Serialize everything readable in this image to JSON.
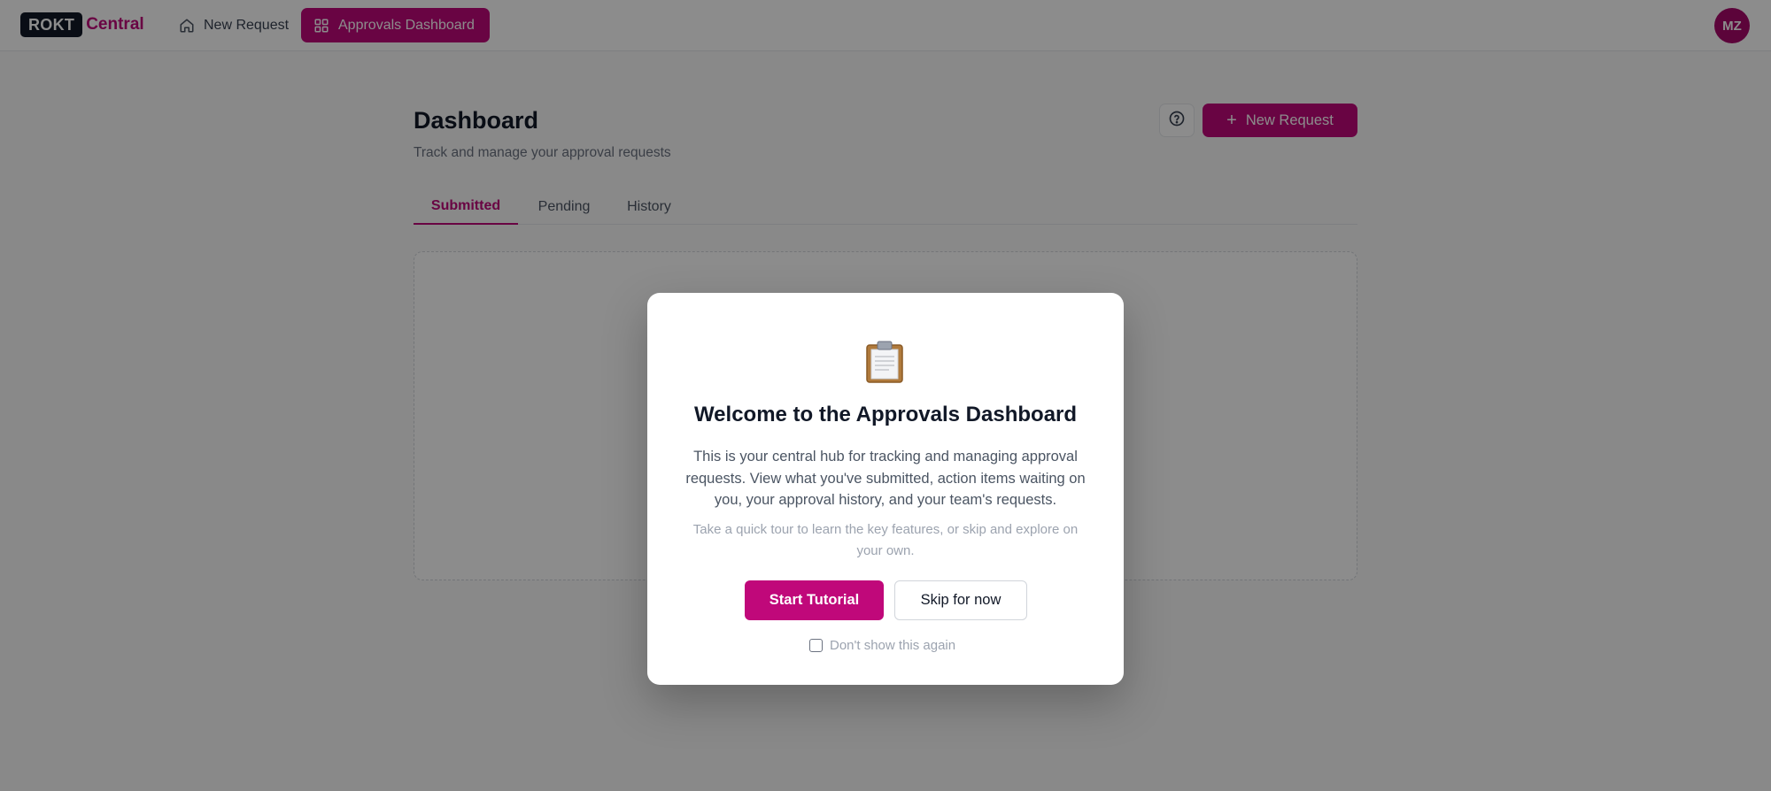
{
  "nav": {
    "logo_mark": "ROKT",
    "logo_text": "Central",
    "items": [
      {
        "label": "New Request",
        "icon": "home-icon"
      },
      {
        "label": "Approvals Dashboard",
        "icon": "grid-icon"
      }
    ],
    "avatar_initials": "MZ"
  },
  "page": {
    "title": "Dashboard",
    "subtitle": "Track and manage your approval requests",
    "new_request_label": "New Request",
    "help_icon": "question-circle-icon",
    "tabs": [
      {
        "label": "Submitted",
        "active": true
      },
      {
        "label": "Pending",
        "active": false
      },
      {
        "label": "History",
        "active": false
      }
    ]
  },
  "modal": {
    "icon": "clipboard-icon",
    "title": "Welcome to the Approvals Dashboard",
    "body": "This is your central hub for tracking and managing approval requests. View what you've submitted, action items waiting on you, your approval history, and your team's requests.",
    "hint": "Take a quick tour to learn the key features, or skip and explore on your own.",
    "start_label": "Start Tutorial",
    "skip_label": "Skip for now",
    "dont_show_label": "Don't show this again",
    "dont_show_checked": false
  },
  "colors": {
    "accent": "#c0087a",
    "overlay": "rgba(0,0,0,0.45)"
  }
}
